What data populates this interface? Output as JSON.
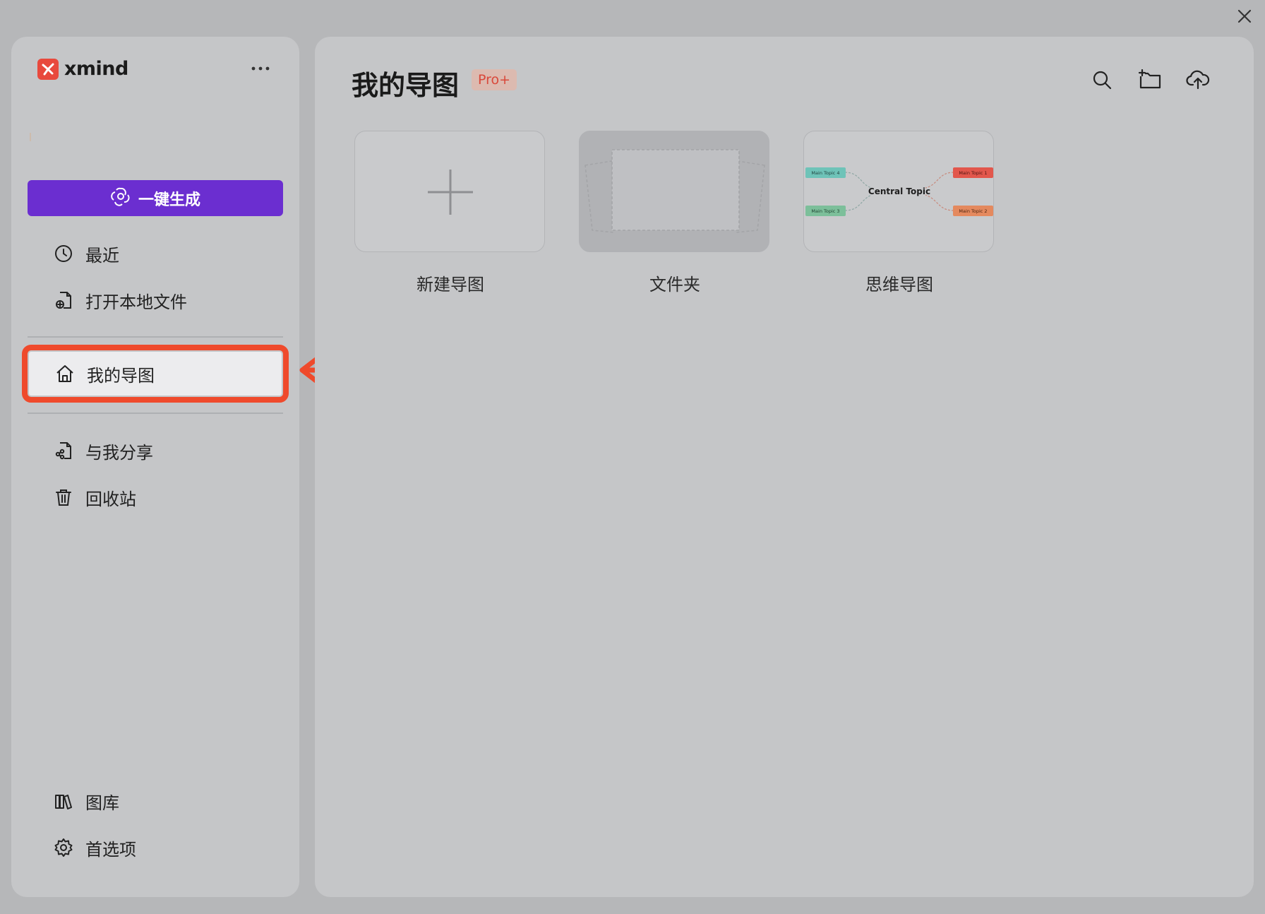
{
  "app": {
    "brand": "xmind",
    "close_icon": "close-icon"
  },
  "sidebar": {
    "ai_button_label": "一键生成",
    "items": [
      {
        "label": "最近",
        "icon": "clock-icon"
      },
      {
        "label": "打开本地文件",
        "icon": "open-file-icon"
      },
      {
        "label": "我的导图",
        "icon": "home-icon",
        "active": true
      },
      {
        "label": "与我分享",
        "icon": "shared-file-icon"
      },
      {
        "label": "回收站",
        "icon": "trash-icon"
      },
      {
        "label": "图库",
        "icon": "library-icon"
      },
      {
        "label": "首选项",
        "icon": "gear-icon"
      }
    ]
  },
  "main": {
    "title": "我的导图",
    "badge": "Pro+",
    "toolbar_icons": [
      "search-icon",
      "new-folder-icon",
      "cloud-upload-icon"
    ],
    "cards": [
      {
        "label": "新建导图",
        "type": "new"
      },
      {
        "label": "文件夹",
        "type": "folder"
      },
      {
        "label": "思维导图",
        "type": "mindmap"
      }
    ],
    "mindmap_preview": {
      "center": "Central Topic",
      "topics": [
        "Main Topic 1",
        "Main Topic 2",
        "Main Topic 3",
        "Main Topic 4"
      ]
    }
  },
  "colors": {
    "accent_purple": "#6b2ed0",
    "highlight_red": "#ef4a2c",
    "brand_red": "#e8493d"
  }
}
